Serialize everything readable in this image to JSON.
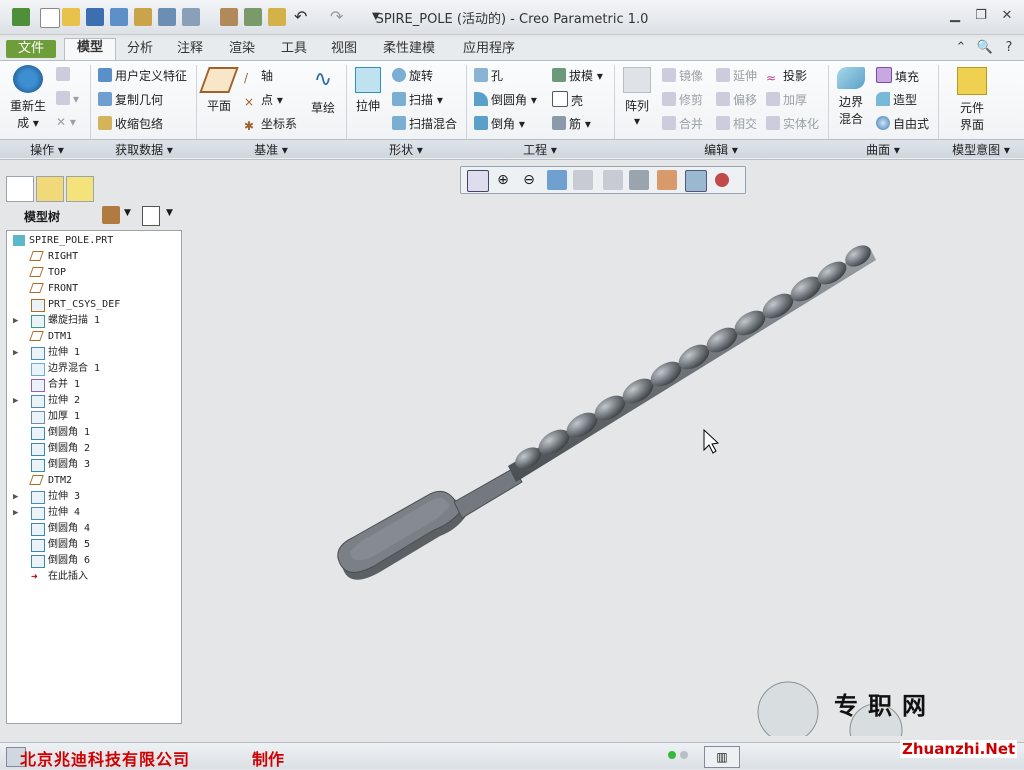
{
  "window": {
    "title": "SPIRE_POLE (活动的) - Creo Parametric 1.0"
  },
  "tabs": [
    {
      "label": "文件"
    },
    {
      "label": "模型"
    },
    {
      "label": "分析"
    },
    {
      "label": "注释"
    },
    {
      "label": "渲染"
    },
    {
      "label": "工具"
    },
    {
      "label": "视图"
    },
    {
      "label": "柔性建模"
    },
    {
      "label": "应用程序"
    }
  ],
  "ribbon": {
    "operations": {
      "regen_line1": "重新生",
      "regen_line2": "成",
      "group": "操作"
    },
    "get_data": {
      "udf": "用户定义特征",
      "copy_geom": "复制几何",
      "shrinkwrap": "收缩包络",
      "group": "获取数据"
    },
    "datum": {
      "plane": "平面",
      "axis": "轴",
      "point": "点",
      "csys": "坐标系",
      "sketch": "草绘",
      "group": "基准"
    },
    "shapes": {
      "extrude": "拉伸",
      "revolve": "旋转",
      "sweep": "扫描",
      "swept_blend": "扫描混合",
      "group": "形状"
    },
    "engineering": {
      "hole": "孔",
      "round": "倒圆角",
      "chamfer": "倒角",
      "draft": "拔模",
      "shell": "壳",
      "rib": "筋",
      "group": "工程"
    },
    "editing": {
      "pattern": "阵列",
      "mirror": "镜像",
      "trim": "修剪",
      "merge": "合并",
      "extend": "延伸",
      "offset": "偏移",
      "intersect": "相交",
      "project": "投影",
      "thicken": "加厚",
      "solidify": "实体化",
      "group": "编辑"
    },
    "surfaces": {
      "boundary_line1": "边界",
      "boundary_line2": "混合",
      "fill": "填充",
      "style": "造型",
      "freestyle": "自由式",
      "group": "曲面"
    },
    "intent": {
      "component_line1": "元件",
      "component_line2": "界面",
      "group": "模型意图"
    }
  },
  "model_tree": {
    "title": "模型树",
    "items": [
      {
        "label": "SPIRE_POLE.PRT",
        "icon": "part-icon",
        "exp": ""
      },
      {
        "label": "RIGHT",
        "icon": "datum-plane-icon",
        "exp": ""
      },
      {
        "label": "TOP",
        "icon": "datum-plane-icon",
        "exp": ""
      },
      {
        "label": "FRONT",
        "icon": "datum-plane-icon",
        "exp": ""
      },
      {
        "label": "PRT_CSYS_DEF",
        "icon": "csys-icon",
        "exp": ""
      },
      {
        "label": "螺旋扫描 1",
        "icon": "helical-sweep-icon",
        "exp": "▶"
      },
      {
        "label": "DTM1",
        "icon": "datum-plane-icon",
        "exp": ""
      },
      {
        "label": "拉伸 1",
        "icon": "extrude-icon",
        "exp": "▶"
      },
      {
        "label": "边界混合 1",
        "icon": "boundary-blend-icon",
        "exp": ""
      },
      {
        "label": "合并 1",
        "icon": "merge-icon",
        "exp": ""
      },
      {
        "label": "拉伸 2",
        "icon": "extrude-icon",
        "exp": "▶"
      },
      {
        "label": "加厚 1",
        "icon": "thicken-icon",
        "exp": ""
      },
      {
        "label": "倒圆角 1",
        "icon": "round-icon",
        "exp": ""
      },
      {
        "label": "倒圆角 2",
        "icon": "round-icon",
        "exp": ""
      },
      {
        "label": "倒圆角 3",
        "icon": "round-icon",
        "exp": ""
      },
      {
        "label": "DTM2",
        "icon": "datum-plane-icon",
        "exp": ""
      },
      {
        "label": "拉伸 3",
        "icon": "extrude-icon",
        "exp": "▶"
      },
      {
        "label": "拉伸 4",
        "icon": "extrude-icon",
        "exp": "▶"
      },
      {
        "label": "倒圆角 4",
        "icon": "round-icon",
        "exp": ""
      },
      {
        "label": "倒圆角 5",
        "icon": "round-icon",
        "exp": ""
      },
      {
        "label": "倒圆角 6",
        "icon": "round-icon",
        "exp": ""
      },
      {
        "label": "在此插入",
        "icon": "insert-arrow-icon",
        "exp": ""
      }
    ]
  },
  "status": {
    "company": "北京兆迪科技有限公司",
    "maker": "制作"
  },
  "watermark": {
    "line1": "专职网",
    "line2": "Zhuanzhi.Net"
  },
  "colors": {
    "file_tab": "#6e9e3a",
    "accent_red": "#d00000",
    "model": "#6f757a"
  }
}
